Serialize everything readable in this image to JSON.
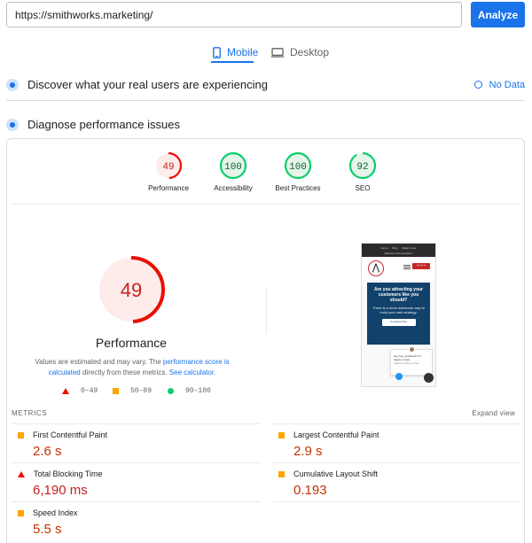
{
  "search": {
    "url": "https://smithworks.marketing/",
    "analyze_label": "Analyze"
  },
  "tabs": [
    {
      "label": "Mobile",
      "active": true,
      "icon": "mobile-phone-icon"
    },
    {
      "label": "Desktop",
      "active": false,
      "icon": "desktop-monitor-icon"
    }
  ],
  "field_data": {
    "title": "Discover what your real users are experiencing",
    "status_label": "No Data"
  },
  "lab_data": {
    "title": "Diagnose performance issues"
  },
  "scores": [
    {
      "value": 49,
      "label": "Performance",
      "status": "fail",
      "color": "#c5221f"
    },
    {
      "value": 100,
      "label": "Accessibility",
      "status": "pass",
      "color": "#0d652d"
    },
    {
      "value": 100,
      "label": "Best Practices",
      "status": "pass",
      "color": "#0d652d"
    },
    {
      "value": 92,
      "label": "SEO",
      "status": "pass",
      "color": "#0d652d"
    }
  ],
  "main_score": {
    "value": 49,
    "label": "Performance"
  },
  "estimate_note": {
    "part1": "Values are estimated and may vary. The ",
    "link1": "performance score is calculated",
    "part2": " directly from these metrics. ",
    "link2": "See calculator."
  },
  "legend": [
    {
      "range": "0–49",
      "shape": "triangle",
      "color": "#eb0f00"
    },
    {
      "range": "50–89",
      "shape": "square",
      "color": "#ffa400"
    },
    {
      "range": "90–100",
      "shape": "circle",
      "color": "#0cce6b"
    }
  ],
  "thumbnail": {
    "nav_items": [
      "Home",
      "Blog",
      "Metal Cover"
    ],
    "nav_sub": "Website Documentation",
    "cta": "Get Started",
    "hero_title": "Are you attracting your customers like you should?",
    "hero_sub": "There is a more awesome way to build your web strategy.",
    "hero_button": "Get Started Now",
    "chat_text": "Hey hey, goodwork! I'm happy to help",
    "chat_sub": "Again produce a chat"
  },
  "metrics": {
    "title": "METRICS",
    "expand_label": "Expand view",
    "items": [
      {
        "label": "First Contentful Paint",
        "value": "2.6 s",
        "status": "average"
      },
      {
        "label": "Largest Contentful Paint",
        "value": "2.9 s",
        "status": "average"
      },
      {
        "label": "Total Blocking Time",
        "value": "6,190 ms",
        "status": "fail"
      },
      {
        "label": "Cumulative Layout Shift",
        "value": "0.193",
        "status": "average"
      },
      {
        "label": "Speed Index",
        "value": "5.5 s",
        "status": "average"
      }
    ]
  }
}
